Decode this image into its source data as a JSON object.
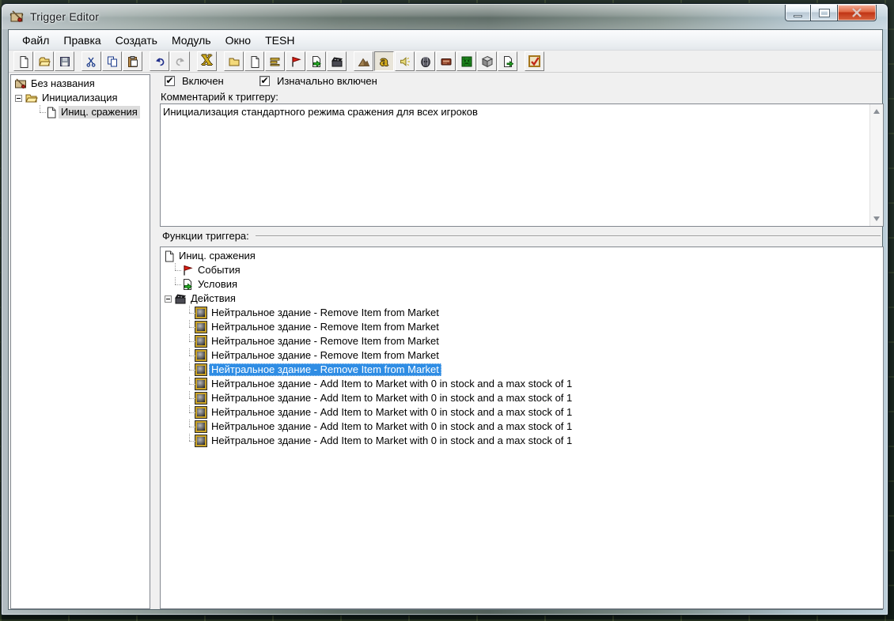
{
  "window": {
    "title": "Trigger Editor"
  },
  "menu": [
    "Файл",
    "Правка",
    "Создать",
    "Модуль",
    "Окно",
    "TESH"
  ],
  "toolbar": {
    "delete_glyph": "X",
    "trigger_editor_glyph": "a"
  },
  "trigger_panel": {
    "enabled_label": "Включен",
    "initially_on_label": "Изначально включен",
    "check_mark": "✔",
    "comment_label": "Комментарий к триггеру:",
    "comment_text": "Инициализация стандартного режима сражения для всех игроков"
  },
  "left_tree": {
    "root": "Без названия",
    "category": "Инициализация",
    "trigger": "Иниц. сражения"
  },
  "functions_panel": {
    "label": "Функции триггера:",
    "root": "Иниц. сражения",
    "events_label": "События",
    "conditions_label": "Условия",
    "actions_label": "Действия",
    "actions": [
      {
        "text": "Нейтральное здание - Remove Item from Market",
        "selected": false
      },
      {
        "text": "Нейтральное здание - Remove Item from Market",
        "selected": false
      },
      {
        "text": "Нейтральное здание - Remove Item from Market",
        "selected": false
      },
      {
        "text": "Нейтральное здание - Remove Item from Market",
        "selected": false
      },
      {
        "text": "Нейтральное здание - Remove Item from Market",
        "selected": true
      },
      {
        "text": "Нейтральное здание - Add Item to Market with 0 in stock and a max stock of 1",
        "selected": false
      },
      {
        "text": "Нейтральное здание - Add Item to Market with 0 in stock and a max stock of 1",
        "selected": false
      },
      {
        "text": "Нейтральное здание - Add Item to Market with 0 in stock and a max stock of 1",
        "selected": false
      },
      {
        "text": "Нейтральное здание - Add Item to Market with 0 in stock and a max stock of 1",
        "selected": false
      },
      {
        "text": "Нейтральное здание - Add Item to Market with 0 in stock and a max stock of 1",
        "selected": false
      }
    ]
  },
  "colors": {
    "selection": "#2f8de4",
    "close_button": "#c13415"
  }
}
